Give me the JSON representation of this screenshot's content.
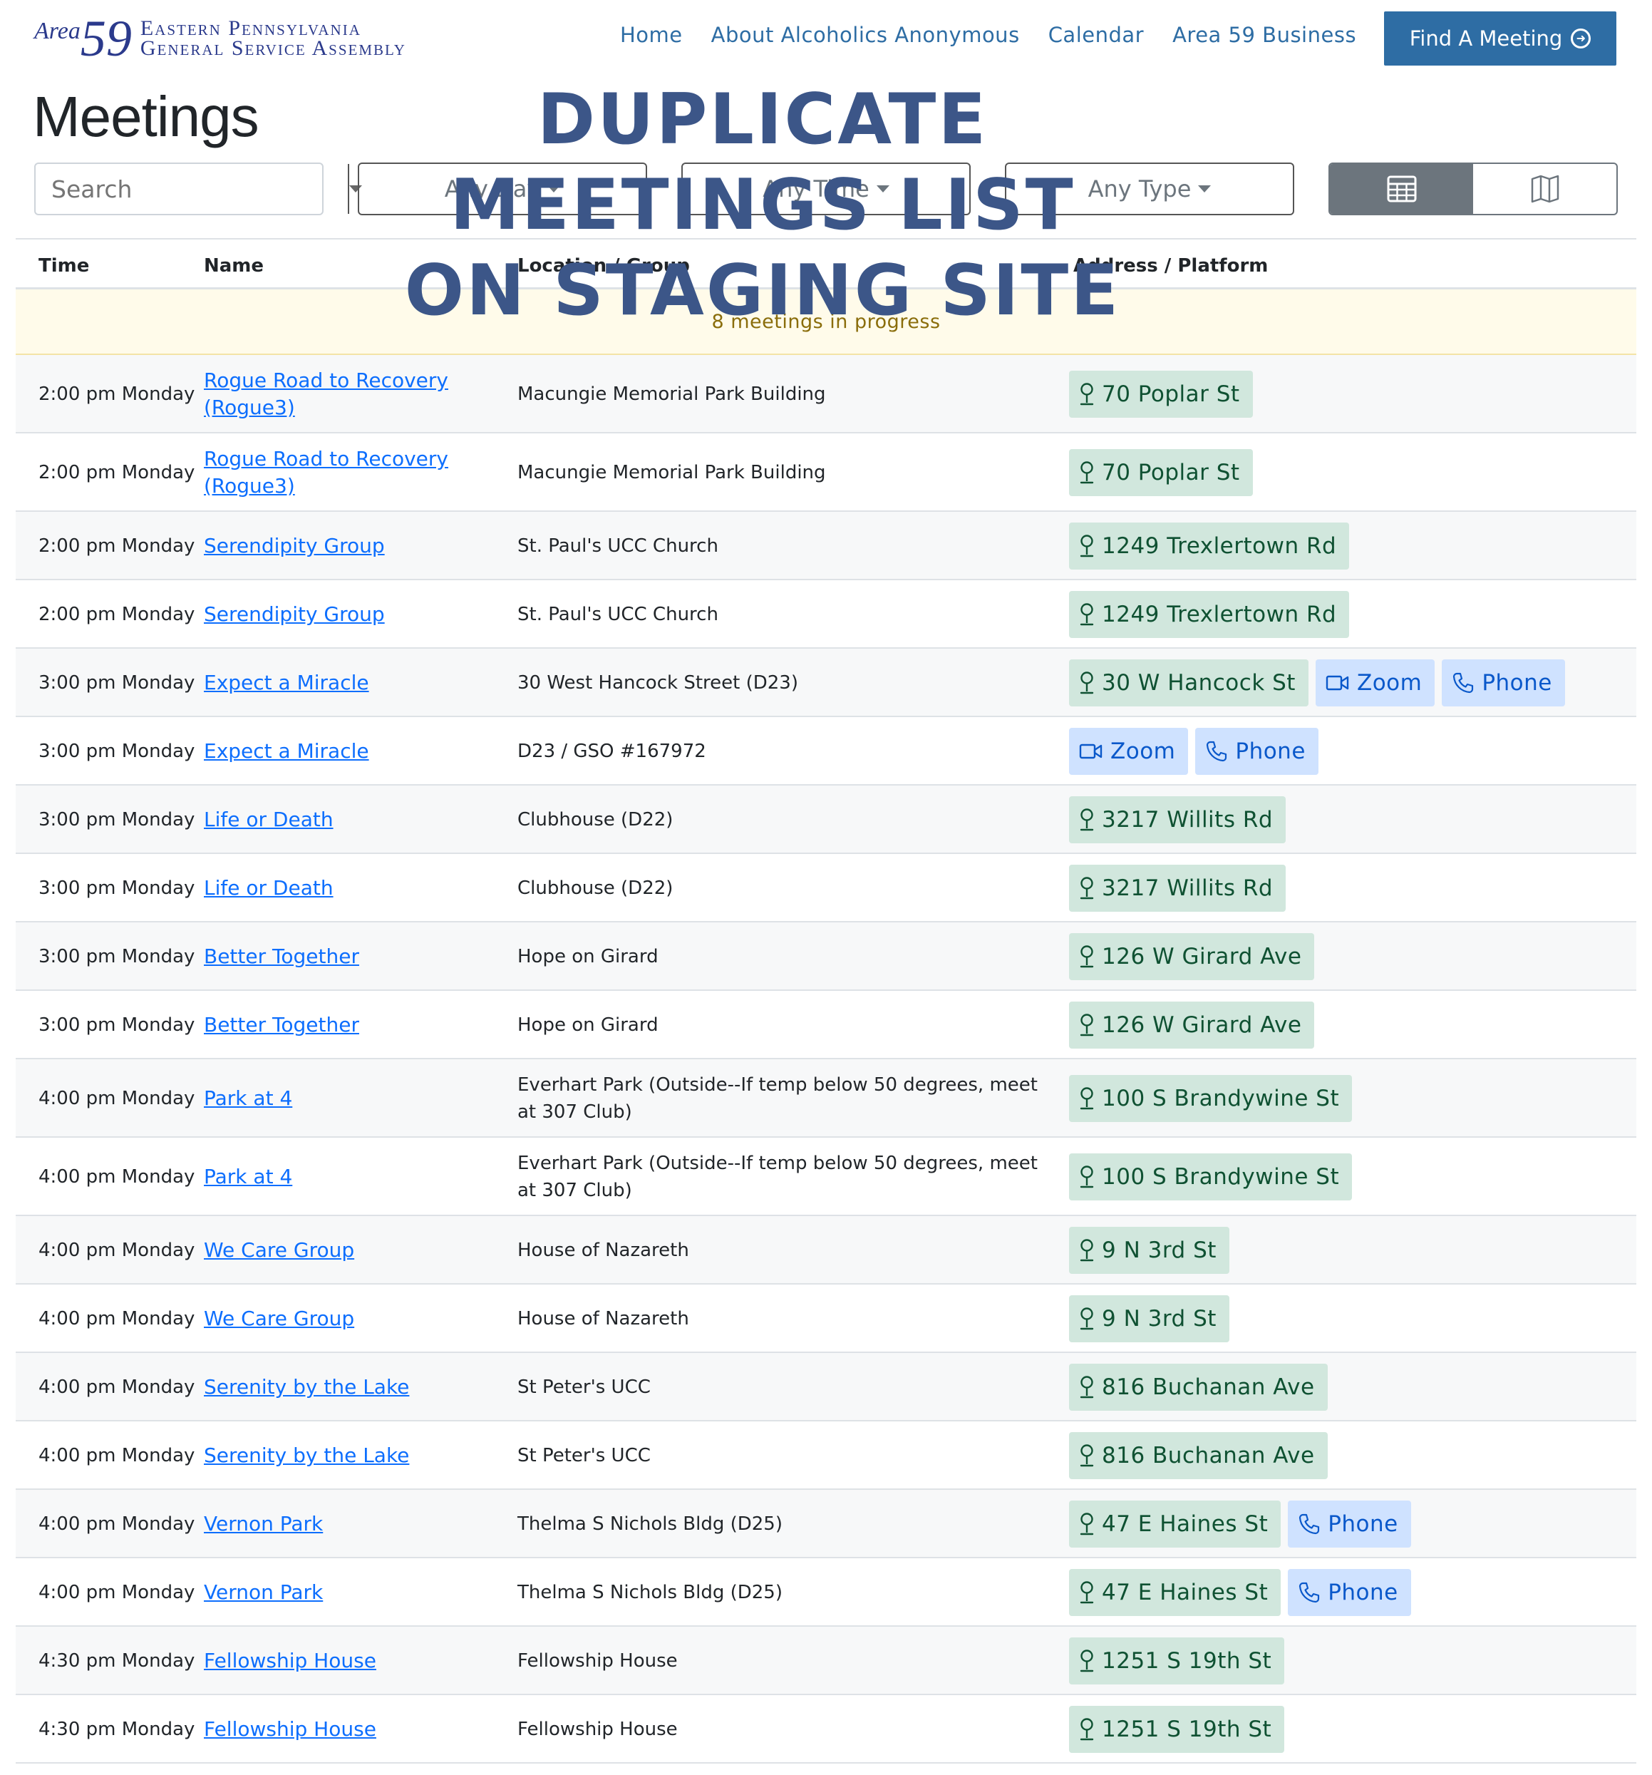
{
  "header": {
    "logo": {
      "area_word": "Area",
      "area_number": "59",
      "line1": "Eastern Pennsylvania",
      "line2": "General Service Assembly"
    },
    "nav": [
      "Home",
      "About Alcoholics Anonymous",
      "Calendar",
      "Area 59 Business"
    ],
    "find_button": "Find A Meeting"
  },
  "page": {
    "title": "Meetings",
    "watermark": [
      "DUPLICATE",
      "MEETINGS LIST",
      "ON STAGING SITE"
    ]
  },
  "filters": {
    "search_placeholder": "Search",
    "day": "Any Day",
    "time": "Any Time",
    "type": "Any Type",
    "view_options": [
      "table-view",
      "map-view"
    ],
    "active_view": "table-view"
  },
  "table": {
    "headers": [
      "Time",
      "Name",
      "Location / Group",
      "Address / Platform"
    ],
    "in_progress": "8 meetings in progress",
    "rows": [
      {
        "time": "2:00 pm Monday",
        "name": "Rogue Road to Recovery (Rogue3)",
        "location": "Macungie Memorial Park Building",
        "badges": [
          {
            "type": "addr",
            "label": "70 Poplar St"
          }
        ]
      },
      {
        "time": "2:00 pm Monday",
        "name": "Rogue Road to Recovery (Rogue3)",
        "location": "Macungie Memorial Park Building",
        "badges": [
          {
            "type": "addr",
            "label": "70 Poplar St"
          }
        ]
      },
      {
        "time": "2:00 pm Monday",
        "name": "Serendipity Group",
        "location": "St. Paul's UCC Church",
        "badges": [
          {
            "type": "addr",
            "label": "1249 Trexlertown Rd"
          }
        ]
      },
      {
        "time": "2:00 pm Monday",
        "name": "Serendipity Group",
        "location": "St. Paul's UCC Church",
        "badges": [
          {
            "type": "addr",
            "label": "1249 Trexlertown Rd"
          }
        ]
      },
      {
        "time": "3:00 pm Monday",
        "name": "Expect a Miracle",
        "location": "30 West Hancock Street (D23)",
        "badges": [
          {
            "type": "addr",
            "label": "30 W Hancock St"
          },
          {
            "type": "zoom",
            "label": "Zoom"
          },
          {
            "type": "phone",
            "label": "Phone"
          }
        ]
      },
      {
        "time": "3:00 pm Monday",
        "name": "Expect a Miracle",
        "location": "D23 / GSO #167972",
        "badges": [
          {
            "type": "zoom",
            "label": "Zoom"
          },
          {
            "type": "phone",
            "label": "Phone"
          }
        ]
      },
      {
        "time": "3:00 pm Monday",
        "name": "Life or Death",
        "location": "Clubhouse (D22)",
        "badges": [
          {
            "type": "addr",
            "label": "3217 Willits Rd"
          }
        ]
      },
      {
        "time": "3:00 pm Monday",
        "name": "Life or Death",
        "location": "Clubhouse (D22)",
        "badges": [
          {
            "type": "addr",
            "label": "3217 Willits Rd"
          }
        ]
      },
      {
        "time": "3:00 pm Monday",
        "name": "Better Together",
        "location": "Hope on Girard",
        "badges": [
          {
            "type": "addr",
            "label": "126 W Girard Ave"
          }
        ]
      },
      {
        "time": "3:00 pm Monday",
        "name": "Better Together",
        "location": "Hope on Girard",
        "badges": [
          {
            "type": "addr",
            "label": "126 W Girard Ave"
          }
        ]
      },
      {
        "time": "4:00 pm Monday",
        "name": "Park at 4",
        "location": "Everhart Park (Outside--If temp below 50 degrees, meet at 307 Club)",
        "badges": [
          {
            "type": "addr",
            "label": "100 S Brandywine St"
          }
        ]
      },
      {
        "time": "4:00 pm Monday",
        "name": "Park at 4",
        "location": "Everhart Park (Outside--If temp below 50 degrees, meet at 307 Club)",
        "badges": [
          {
            "type": "addr",
            "label": "100 S Brandywine St"
          }
        ]
      },
      {
        "time": "4:00 pm Monday",
        "name": "We Care Group",
        "location": "House of Nazareth",
        "badges": [
          {
            "type": "addr",
            "label": "9 N 3rd St"
          }
        ]
      },
      {
        "time": "4:00 pm Monday",
        "name": "We Care Group",
        "location": "House of Nazareth",
        "badges": [
          {
            "type": "addr",
            "label": "9 N 3rd St"
          }
        ]
      },
      {
        "time": "4:00 pm Monday",
        "name": "Serenity by the Lake",
        "location": "St Peter's UCC",
        "badges": [
          {
            "type": "addr",
            "label": "816 Buchanan Ave"
          }
        ]
      },
      {
        "time": "4:00 pm Monday",
        "name": "Serenity by the Lake",
        "location": "St Peter's UCC",
        "badges": [
          {
            "type": "addr",
            "label": "816 Buchanan Ave"
          }
        ]
      },
      {
        "time": "4:00 pm Monday",
        "name": "Vernon Park",
        "location": "Thelma S Nichols Bldg (D25)",
        "badges": [
          {
            "type": "addr",
            "label": "47 E Haines St"
          },
          {
            "type": "phone",
            "label": "Phone"
          }
        ]
      },
      {
        "time": "4:00 pm Monday",
        "name": "Vernon Park",
        "location": "Thelma S Nichols Bldg (D25)",
        "badges": [
          {
            "type": "addr",
            "label": "47 E Haines St"
          },
          {
            "type": "phone",
            "label": "Phone"
          }
        ]
      },
      {
        "time": "4:30 pm Monday",
        "name": "Fellowship House",
        "location": "Fellowship House",
        "badges": [
          {
            "type": "addr",
            "label": "1251 S 19th St"
          }
        ]
      },
      {
        "time": "4:30 pm Monday",
        "name": "Fellowship House",
        "location": "Fellowship House",
        "badges": [
          {
            "type": "addr",
            "label": "1251 S 19th St"
          }
        ]
      }
    ]
  },
  "colors": {
    "brand": "#2b3a8c",
    "nav_link": "#2e6da4",
    "address_badge_bg": "#d1e7dd",
    "address_badge_text": "#0f5132",
    "online_badge_bg": "#cfe2ff",
    "online_badge_text": "#0a58ca",
    "watermark": "#3c5688"
  }
}
